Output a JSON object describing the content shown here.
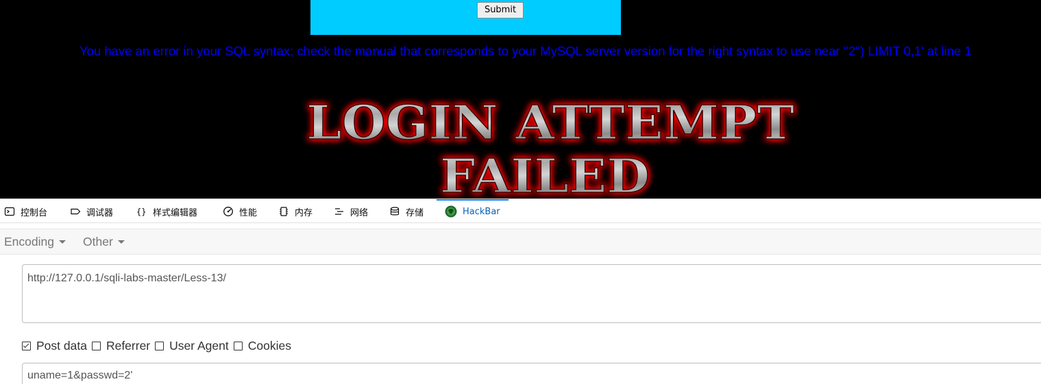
{
  "webpage": {
    "submit_label": "Submit",
    "sql_error": "You have an error in your SQL syntax; check the manual that corresponds to your MySQL server version for the right syntax to use near ''2'') LIMIT 0,1' at line 1",
    "banner_line1": "LOGIN ATTEMPT",
    "banner_line2": "FAILED",
    "colors": {
      "form_bg": "#00ccff",
      "error_text": "#0000ff",
      "banner_glow": "#ff0000"
    }
  },
  "devtools": {
    "tabs": [
      {
        "label": "控制台",
        "icon": "console-icon"
      },
      {
        "label": "调试器",
        "icon": "debugger-icon"
      },
      {
        "label": "样式编辑器",
        "icon": "style-editor-icon"
      },
      {
        "label": "性能",
        "icon": "performance-icon"
      },
      {
        "label": "内存",
        "icon": "memory-icon"
      },
      {
        "label": "网络",
        "icon": "network-icon"
      },
      {
        "label": "存储",
        "icon": "storage-icon"
      },
      {
        "label": "HackBar",
        "icon": "hackbar-icon",
        "active": true
      }
    ]
  },
  "hackbar": {
    "menus": [
      {
        "label": "Encoding"
      },
      {
        "label": "Other"
      }
    ],
    "url_value": "http://127.0.0.1/sqli-labs-master/Less-13/",
    "checkboxes": [
      {
        "label": "Post data",
        "checked": true
      },
      {
        "label": "Referrer",
        "checked": false
      },
      {
        "label": "User Agent",
        "checked": false
      },
      {
        "label": "Cookies",
        "checked": false
      }
    ],
    "post_value": "uname=1&passwd=2'"
  }
}
